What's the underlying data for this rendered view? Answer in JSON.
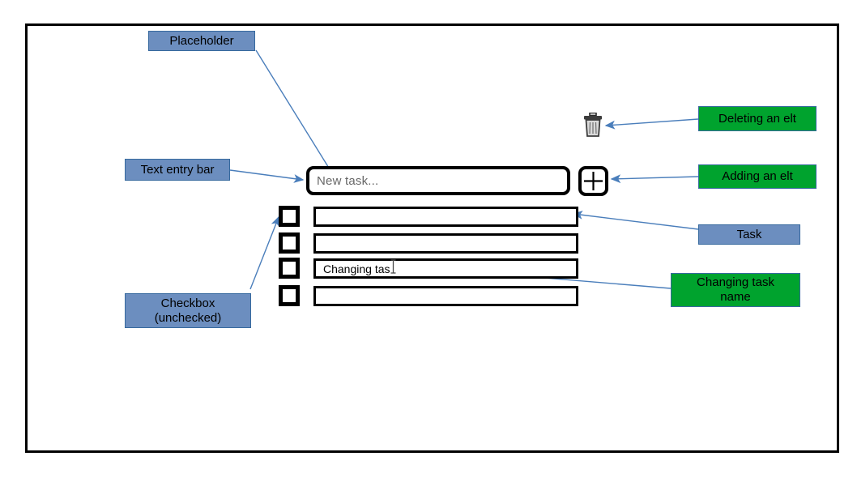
{
  "diagram": {
    "title_visible": false,
    "colors": {
      "note_blue": "#6c8ebf",
      "note_green": "#00a32e",
      "note_border": "#36699e",
      "connector": "#4a7ebb",
      "widget_outline": "#000000",
      "placeholder_text": "#676767",
      "canvas_background": "#ffffff"
    }
  },
  "annotations": [
    {
      "id": "placeholder",
      "label": "Placeholder",
      "style": "blue"
    },
    {
      "id": "text-entry-bar",
      "label": "Text entry bar",
      "style": "blue"
    },
    {
      "id": "checkbox",
      "label": "Checkbox\n(unchecked)",
      "line1": "Checkbox",
      "line2": "(unchecked)",
      "style": "blue"
    },
    {
      "id": "deleting-an-elt",
      "label": "Deleting an elt",
      "style": "green"
    },
    {
      "id": "adding-an-elt",
      "label": "Adding an elt",
      "style": "green"
    },
    {
      "id": "task",
      "label": "Task",
      "style": "blue"
    },
    {
      "id": "changing-task-name",
      "label": "Changing task name",
      "line1": "Changing task",
      "line2": "name",
      "style": "green"
    }
  ],
  "app": {
    "entry_bar": {
      "placeholder": "New task...",
      "value": ""
    },
    "add_button": {
      "icon": "plus-icon"
    },
    "delete_button": {
      "icon": "trash-icon"
    },
    "tasks": [
      {
        "index": 1,
        "checked": false,
        "text": ""
      },
      {
        "index": 2,
        "checked": false,
        "text": ""
      },
      {
        "index": 3,
        "checked": false,
        "text": "Changing tas"
      },
      {
        "index": 4,
        "checked": false,
        "text": ""
      }
    ],
    "cursor": {
      "type": "ibeam-cursor"
    }
  }
}
